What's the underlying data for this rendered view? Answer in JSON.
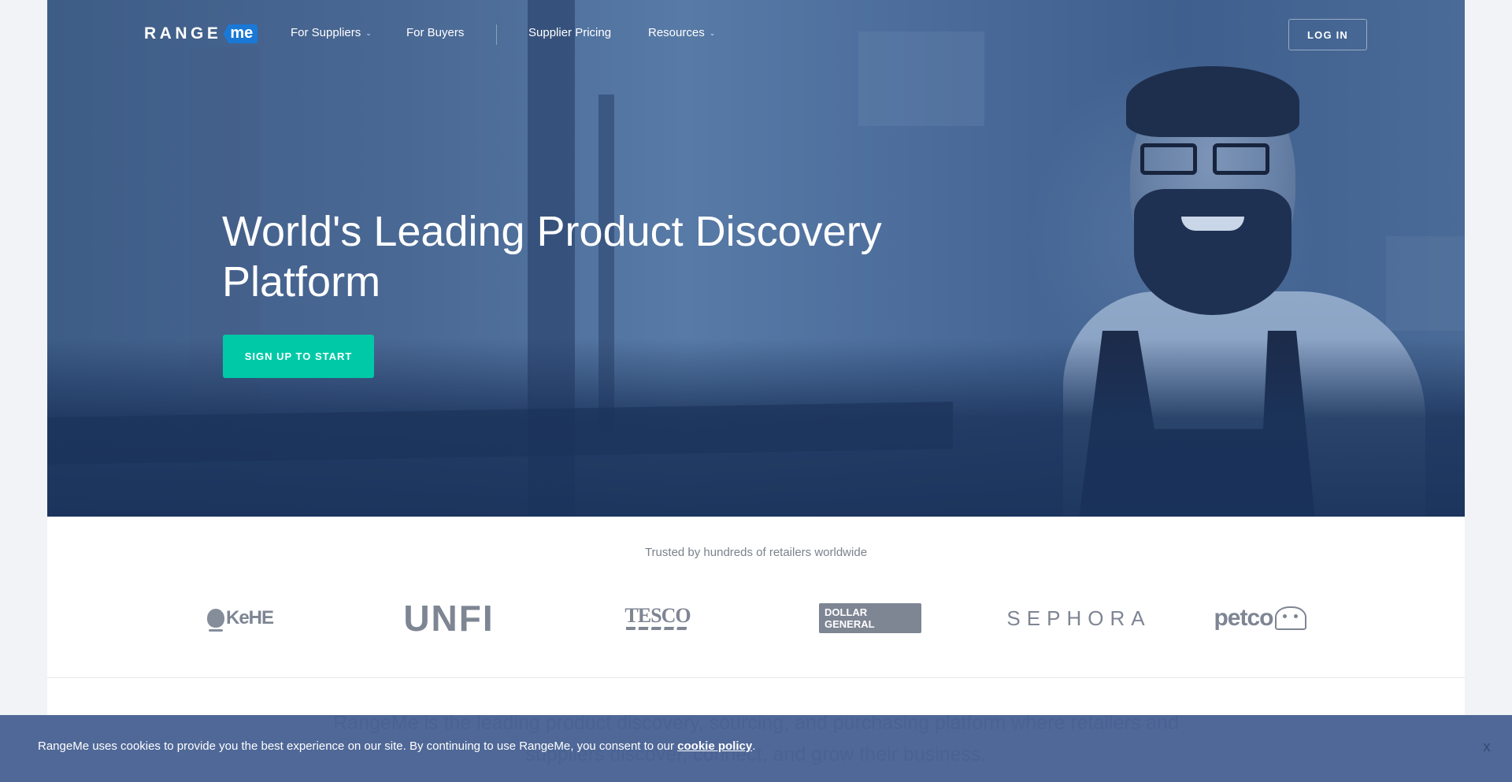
{
  "nav": {
    "logo": {
      "range": "RANGE",
      "me": "me"
    },
    "items": [
      {
        "label": "For Suppliers",
        "has_dropdown": true,
        "chevron": "⌄"
      },
      {
        "label": "For Buyers",
        "has_dropdown": false
      },
      {
        "label": "Supplier Pricing",
        "has_dropdown": false
      },
      {
        "label": "Resources",
        "has_dropdown": true,
        "chevron": "⌄"
      }
    ],
    "login_label": "LOG IN"
  },
  "hero": {
    "title": "World's Leading Product Discovery Platform",
    "cta_label": "SIGN UP TO START",
    "image": "smiling bearded man in glasses wearing an apron, blue overlay"
  },
  "trusted": {
    "heading": "Trusted by hundreds of retailers worldwide",
    "logos": [
      {
        "name": "KeHE",
        "text": "KeHE"
      },
      {
        "name": "UNFI",
        "text": "UNFI"
      },
      {
        "name": "Tesco",
        "text": "TESCO"
      },
      {
        "name": "Dollar General",
        "text": "DOLLAR GENERAL"
      },
      {
        "name": "Sephora",
        "text": "SEPHORA"
      },
      {
        "name": "Petco",
        "text": "petco"
      }
    ]
  },
  "intro": {
    "text": "RangeMe is the leading product discovery, sourcing, and purchasing platform where retailers and suppliers discover, connect, and grow their business."
  },
  "cookie": {
    "text": "RangeMe uses cookies to provide you the best experience on our site. By continuing to use RangeMe, you consent to our ",
    "link_label": "cookie policy",
    "suffix": ".",
    "close_label": "x"
  },
  "colors": {
    "accent": "#00c9a7",
    "logo_badge": "#1a78d6",
    "hero_overlay": "#3d5c86",
    "cookie_bg": "#496394",
    "page_bg": "#f1f3f6"
  }
}
